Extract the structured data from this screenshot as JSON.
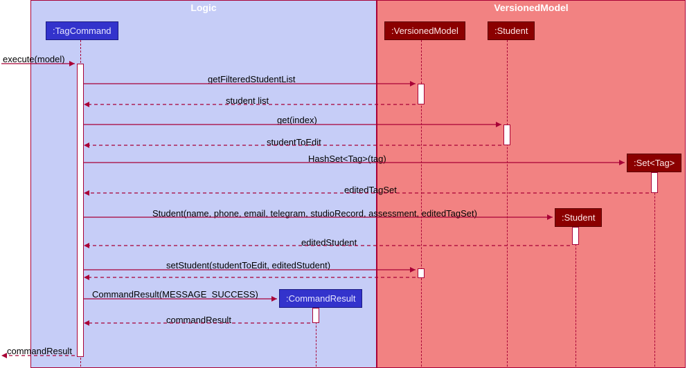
{
  "frames": {
    "logic": "Logic",
    "versioned": "VersionedModel"
  },
  "participants": {
    "tagCommand": ":TagCommand",
    "versionedModel": ":VersionedModel",
    "student": ":Student",
    "setTag": ":Set<Tag>",
    "studentNew": ":Student",
    "commandResult": ":CommandResult"
  },
  "messages": {
    "execute": "execute(model)",
    "getFiltered": "getFilteredStudentList",
    "studentList": "student list",
    "getIndex": "get(index)",
    "studentToEdit": "studentToEdit",
    "hashSetTag": "HashSet<Tag>(tag)",
    "editedTagSet": "editedTagSet",
    "studentCtor": "Student(name, phone, email, telegram, studioRecord, assessment, editedTagSet)",
    "editedStudent": "editedStudent",
    "setStudent": "setStudent(studentToEdit, editedStudent)",
    "cmdResultCtor": "CommandResult(MESSAGE_SUCCESS)",
    "commandResultRet": "commandResult",
    "commandResultFinal": "commandResult"
  },
  "chart_data": {
    "type": "sequence_diagram",
    "frames": [
      {
        "name": "Logic",
        "contains": [
          ":TagCommand",
          ":CommandResult"
        ]
      },
      {
        "name": "VersionedModel",
        "contains": [
          ":VersionedModel",
          ":Student",
          ":Set<Tag>",
          ":Student"
        ]
      }
    ],
    "participants": [
      ":TagCommand",
      ":VersionedModel",
      ":Student",
      ":Set<Tag>",
      ":Student",
      ":CommandResult"
    ],
    "interactions": [
      {
        "from": "caller",
        "to": ":TagCommand",
        "label": "execute(model)",
        "type": "call"
      },
      {
        "from": ":TagCommand",
        "to": ":VersionedModel",
        "label": "getFilteredStudentList",
        "type": "call"
      },
      {
        "from": ":VersionedModel",
        "to": ":TagCommand",
        "label": "student list",
        "type": "return"
      },
      {
        "from": ":TagCommand",
        "to": ":Student",
        "label": "get(index)",
        "type": "call"
      },
      {
        "from": ":Student",
        "to": ":TagCommand",
        "label": "studentToEdit",
        "type": "return"
      },
      {
        "from": ":TagCommand",
        "to": ":Set<Tag>",
        "label": "HashSet<Tag>(tag)",
        "type": "create"
      },
      {
        "from": ":Set<Tag>",
        "to": ":TagCommand",
        "label": "editedTagSet",
        "type": "return"
      },
      {
        "from": ":TagCommand",
        "to": ":Student",
        "label": "Student(name, phone, email, telegram, studioRecord, assessment, editedTagSet)",
        "type": "create"
      },
      {
        "from": ":Student",
        "to": ":TagCommand",
        "label": "editedStudent",
        "type": "return"
      },
      {
        "from": ":TagCommand",
        "to": ":VersionedModel",
        "label": "setStudent(studentToEdit, editedStudent)",
        "type": "call"
      },
      {
        "from": ":VersionedModel",
        "to": ":TagCommand",
        "label": "",
        "type": "return"
      },
      {
        "from": ":TagCommand",
        "to": ":CommandResult",
        "label": "CommandResult(MESSAGE_SUCCESS)",
        "type": "create"
      },
      {
        "from": ":CommandResult",
        "to": ":TagCommand",
        "label": "commandResult",
        "type": "return"
      },
      {
        "from": ":TagCommand",
        "to": "caller",
        "label": "commandResult",
        "type": "return"
      }
    ]
  }
}
